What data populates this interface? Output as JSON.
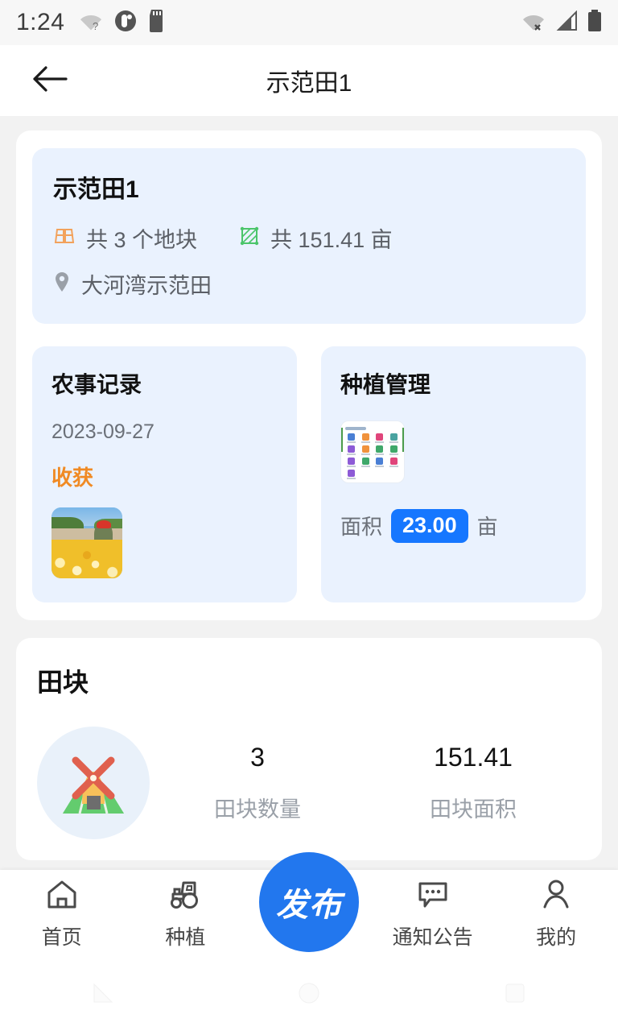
{
  "status_bar": {
    "time": "1:24",
    "left_icons": [
      "wifi-question-icon",
      "circle-status-icon",
      "sd-card-icon"
    ],
    "right_icons": [
      "wifi-off-icon",
      "cellular-signal-icon",
      "battery-full-icon"
    ]
  },
  "app_bar": {
    "back_icon": "back-arrow-icon",
    "title": "示范田1"
  },
  "info_card": {
    "name": "示范田1",
    "plots_icon": "parcel-icon",
    "plots_text": "共 3 个地块",
    "area_icon": "area-hatch-icon",
    "area_text": "共 151.41 亩",
    "location_icon": "location-pin-icon",
    "location_text": "大河湾示范田"
  },
  "farm_record_card": {
    "title": "农事记录",
    "date": "2023-09-27",
    "activity": "收获",
    "activity_color": "#f08a24",
    "photo_name": "corn-harvest-photo"
  },
  "planting_card": {
    "title": "种植管理",
    "thumbnail_name": "planting-app-grid-screenshot",
    "area_label": "面积",
    "area_value": "23.00",
    "area_unit": "亩",
    "badge_color": "#1677ff"
  },
  "field_section": {
    "title": "田块",
    "icon_name": "windmill-icon",
    "stats": [
      {
        "value": "3",
        "label": "田块数量"
      },
      {
        "value": "151.41",
        "label": "田块面积"
      }
    ]
  },
  "bottom_nav": {
    "items": [
      {
        "label": "首页",
        "icon": "home-icon"
      },
      {
        "label": "种植",
        "icon": "tractor-icon"
      },
      {
        "label": "通知公告",
        "icon": "chat-bubble-icon"
      },
      {
        "label": "我的",
        "icon": "person-icon"
      }
    ],
    "fab_label": "发布",
    "fab_color": "#2277ee"
  },
  "android_nav": {
    "back": "android-back-icon",
    "home": "android-home-icon",
    "recents": "android-recents-icon"
  }
}
